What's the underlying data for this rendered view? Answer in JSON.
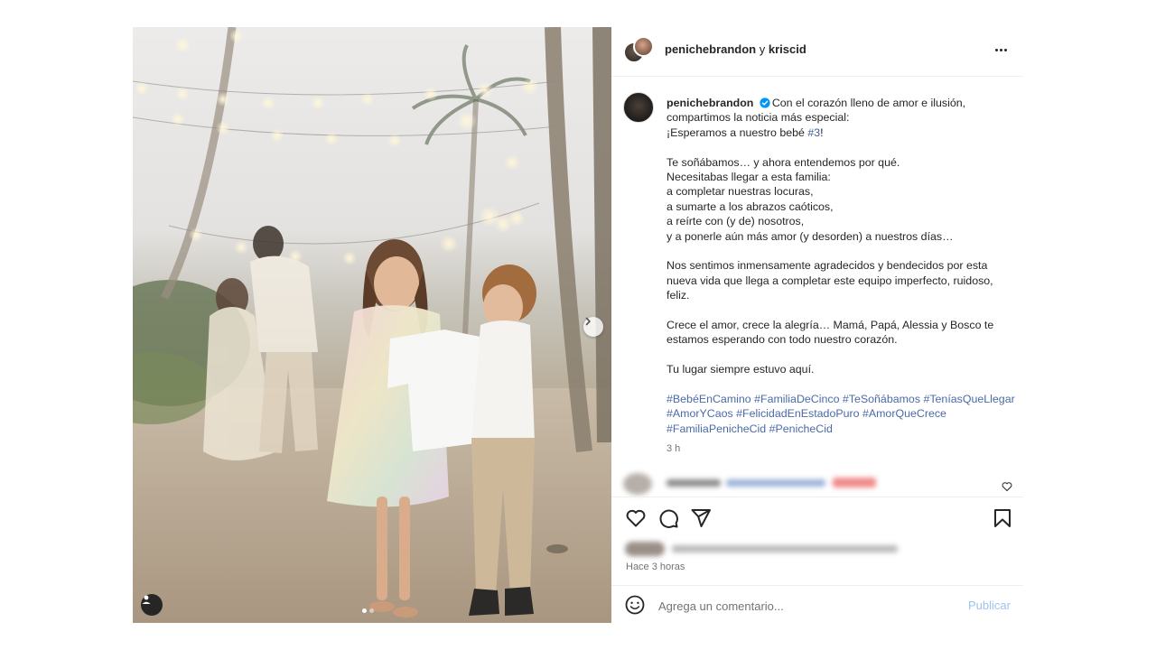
{
  "post": {
    "header": {
      "author": "penichebrandon",
      "conjunction": "y",
      "collaborator": "kriscid",
      "more_icon": "more-horizontal-icon"
    },
    "caption": {
      "username": "penichebrandon",
      "verified_icon": "verified-badge-icon",
      "lines": [
        "Con el corazón lleno de amor e ilusión,",
        "compartimos la noticia más especial:",
        "¡Esperamos a nuestro bebé "
      ],
      "hashtag_inline": "#3",
      "after_hashtag": "!",
      "paragraph2": [
        "Te soñábamos… y ahora entendemos por qué.",
        "Necesitabas llegar a esta familia:",
        "a completar nuestras locuras,",
        "a sumarte a los abrazos caóticos,",
        "a reírte con (y de) nosotros,",
        "y a ponerle aún más amor (y desorden) a nuestros días…"
      ],
      "paragraph3": [
        "Nos sentimos inmensamente agradecidos y bendecidos por esta",
        "nueva vida que llega a completar este equipo imperfecto, ruidoso,",
        "feliz."
      ],
      "paragraph4": [
        "Crece el amor, crece la alegría… Mamá, Papá, Alessia y Bosco te",
        "estamos esperando con todo nuestro corazón."
      ],
      "paragraph5": "Tu lugar siempre estuvo aquí.",
      "hashtags": [
        "#BebéEnCamino #FamiliaDeCinco #TeSoñábamos #TeníasQueLlegar",
        "#AmorYCaos #FelicidadEnEstadoPuro #AmorQueCrece",
        "#FamiliaPenicheCid #PenicheCid"
      ],
      "age": "3 h"
    },
    "actions": {
      "like_icon": "heart-icon",
      "comment_icon": "comment-icon",
      "share_icon": "send-icon",
      "save_icon": "bookmark-icon"
    },
    "timestamp": "Hace 3 horas",
    "carousel": {
      "slide_count": 2,
      "active_slide": 1,
      "next_icon": "chevron-right-icon",
      "tag_icon": "user-tag-icon"
    },
    "comment_box": {
      "emoji_icon": "emoji-icon",
      "placeholder": "Agrega un comentario...",
      "publish_label": "Publicar"
    },
    "colors": {
      "link": "#3d5e9e",
      "publish": "#9fc3ee",
      "muted": "#737373"
    }
  }
}
